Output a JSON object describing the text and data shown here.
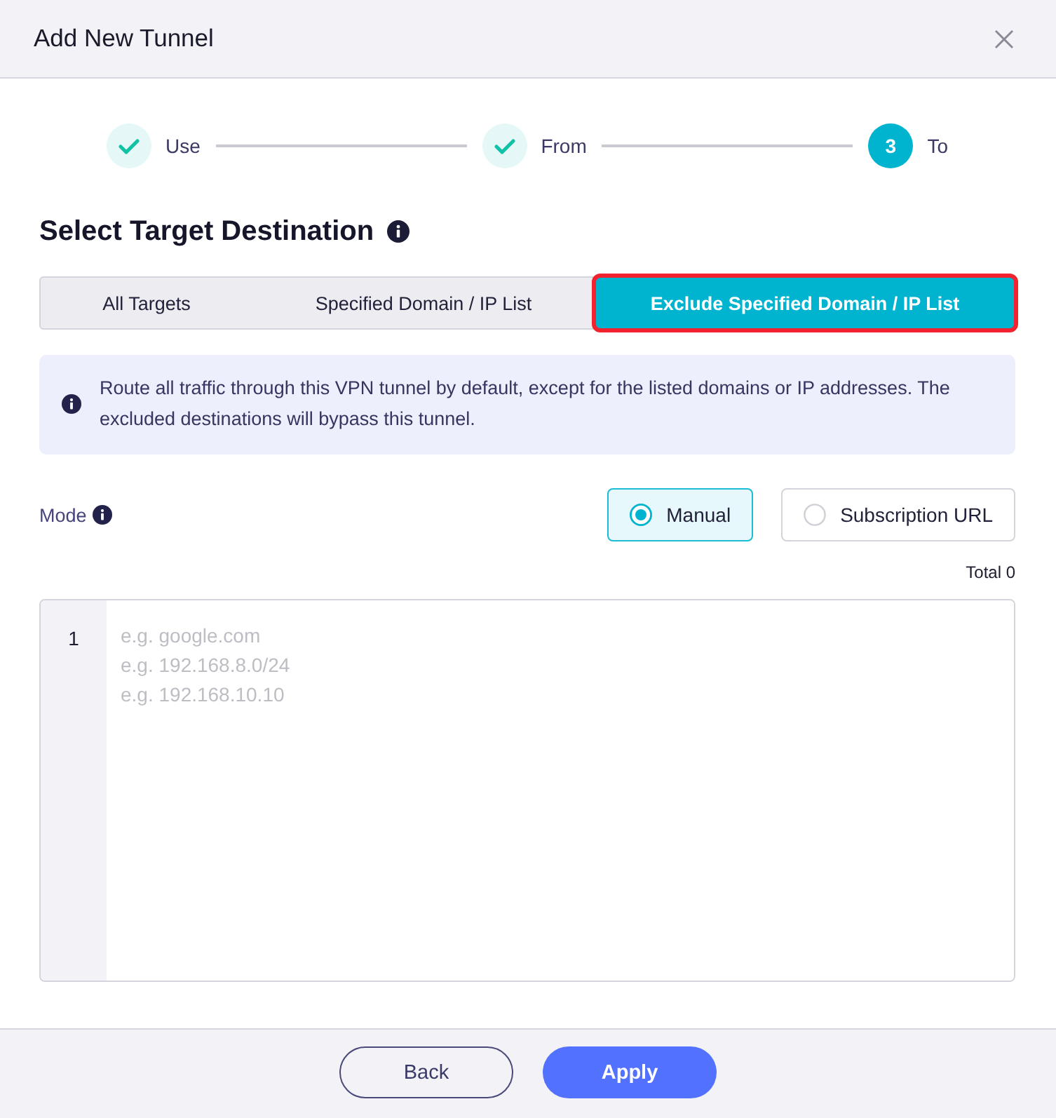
{
  "dialog": {
    "title": "Add New Tunnel"
  },
  "steps": [
    {
      "label": "Use",
      "kind": "done"
    },
    {
      "label": "From",
      "kind": "done"
    },
    {
      "label": "To",
      "kind": "current",
      "number": "3"
    }
  ],
  "section": {
    "title": "Select Target Destination"
  },
  "tabs": [
    {
      "label": "All Targets",
      "selected": false,
      "highlighted": false
    },
    {
      "label": "Specified Domain / IP List",
      "selected": false,
      "highlighted": false
    },
    {
      "label": "Exclude Specified Domain / IP List",
      "selected": true,
      "highlighted": true
    }
  ],
  "notice": {
    "text": "Route all traffic through this VPN tunnel by default, except for the listed domains or IP addresses. The excluded destinations will bypass this tunnel."
  },
  "mode": {
    "label": "Mode",
    "options": [
      {
        "label": "Manual",
        "selected": true
      },
      {
        "label": "Subscription URL",
        "selected": false
      }
    ]
  },
  "total": "Total 0",
  "editor": {
    "line_numbers": [
      "1"
    ],
    "placeholder": "e.g. google.com\ne.g. 192.168.8.0/24\ne.g. 192.168.10.10"
  },
  "buttons": [
    {
      "label": "Back",
      "kind": "secondary"
    },
    {
      "label": "Apply",
      "kind": "primary"
    }
  ]
}
